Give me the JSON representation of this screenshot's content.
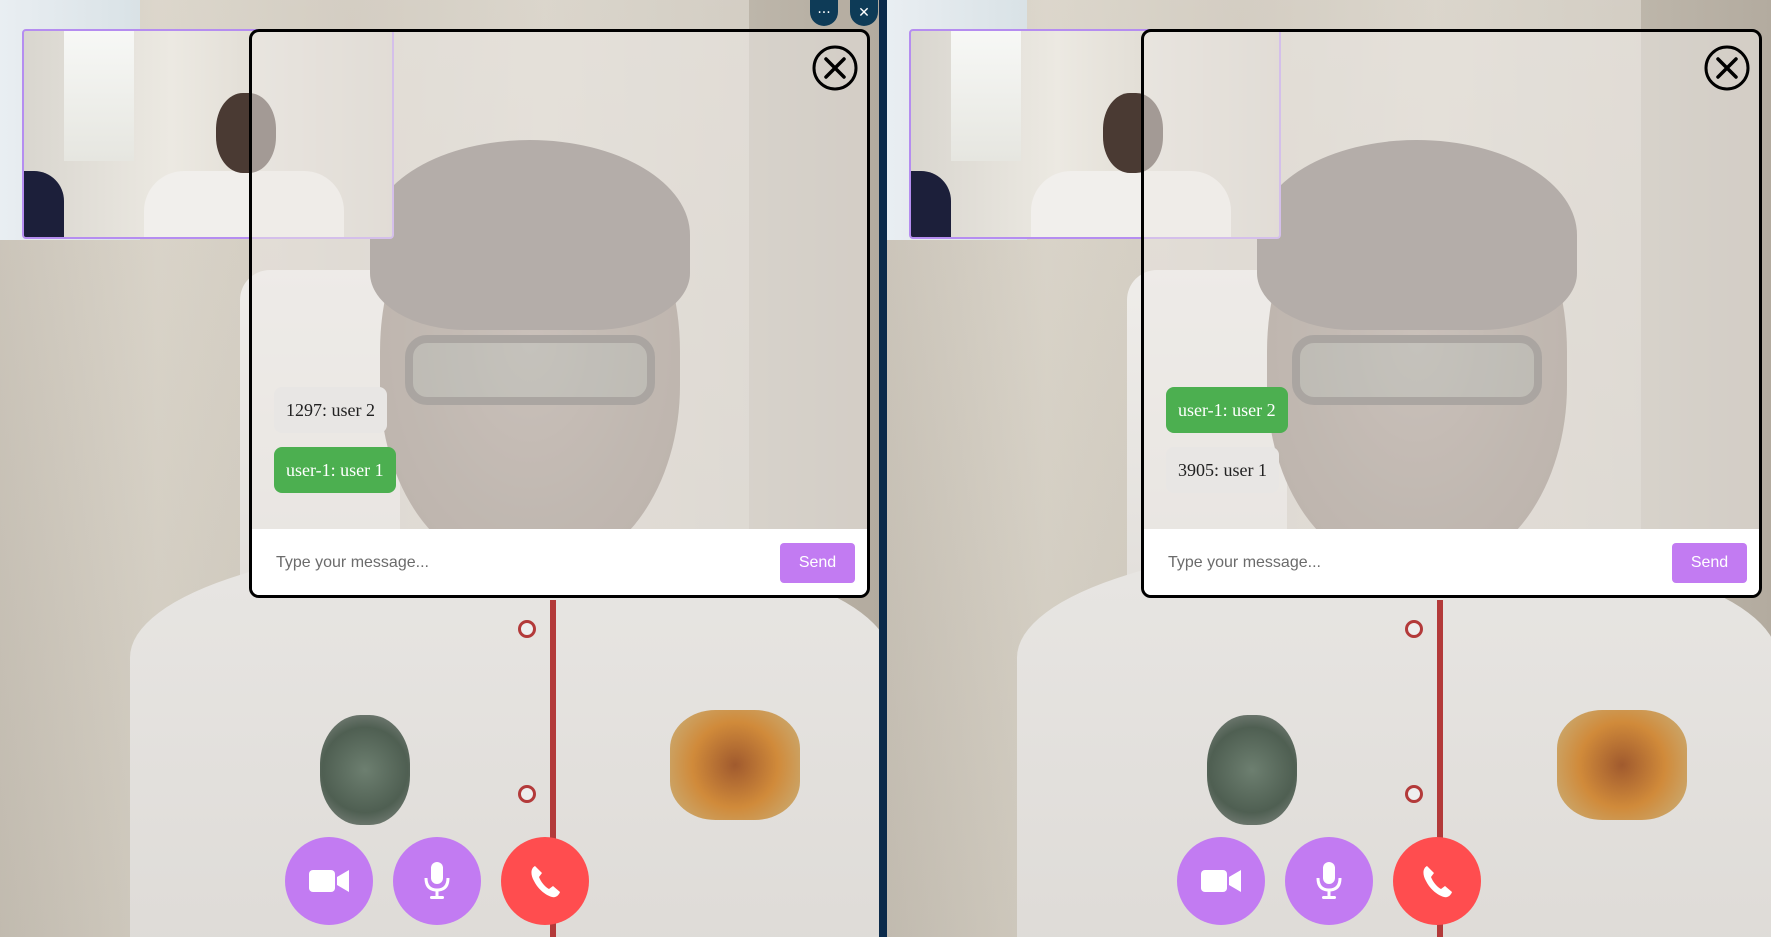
{
  "window_controls": {
    "more_label": "···",
    "close_label": "✕"
  },
  "panes": [
    {
      "messages": [
        {
          "text": "1297: user 2",
          "style": "gray"
        },
        {
          "text": "user-1: user 1",
          "style": "green"
        }
      ],
      "composer": {
        "placeholder": "Type your message...",
        "send_label": "Send"
      }
    },
    {
      "messages": [
        {
          "text": "user-1: user 2",
          "style": "green"
        },
        {
          "text": "3905: user 1",
          "style": "gray"
        }
      ],
      "composer": {
        "placeholder": "Type your message...",
        "send_label": "Send"
      }
    }
  ],
  "controls": {
    "camera_icon": "video-camera-icon",
    "mic_icon": "microphone-icon",
    "hangup_icon": "phone-hangup-icon"
  },
  "colors": {
    "accent_purple": "#c27bf2",
    "hangup_red": "#ff4d4f",
    "message_green": "#4caf50",
    "message_gray": "#e8e6e4",
    "pip_border": "#b58df0"
  }
}
